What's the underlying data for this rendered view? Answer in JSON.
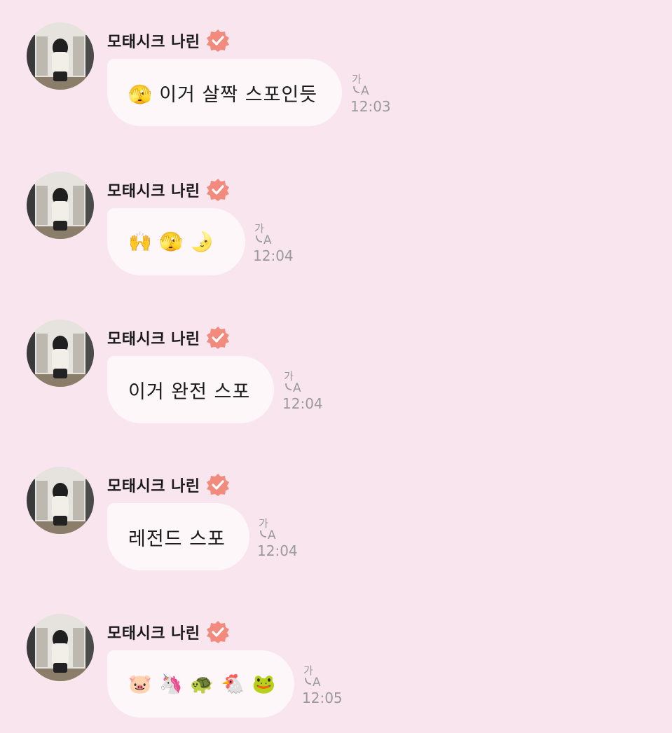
{
  "messages": [
    {
      "sender": "모태시크 나린",
      "text": "🫣 이거 살짝 스포인듯",
      "time": "12:03",
      "translate_icon": "translate-icon"
    },
    {
      "sender": "모태시크 나린",
      "text": "🙌  🫣  🌛",
      "time": "12:04",
      "translate_icon": "translate-icon"
    },
    {
      "sender": "모태시크 나린",
      "text": "이거 완전 스포",
      "time": "12:04",
      "translate_icon": "translate-icon"
    },
    {
      "sender": "모태시크 나린",
      "text": "레전드 스포",
      "time": "12:04",
      "translate_icon": "translate-icon"
    },
    {
      "sender": "모태시크 나린",
      "text": "🐷 🦄 🐢 🐔 🐸",
      "time": "12:05",
      "translate_icon": "translate-icon"
    }
  ],
  "colors": {
    "background": "#f9e5ee",
    "bubble": "#fdf7f9",
    "verified_badge": "#f28b7d",
    "timestamp": "#9a9a9a"
  }
}
